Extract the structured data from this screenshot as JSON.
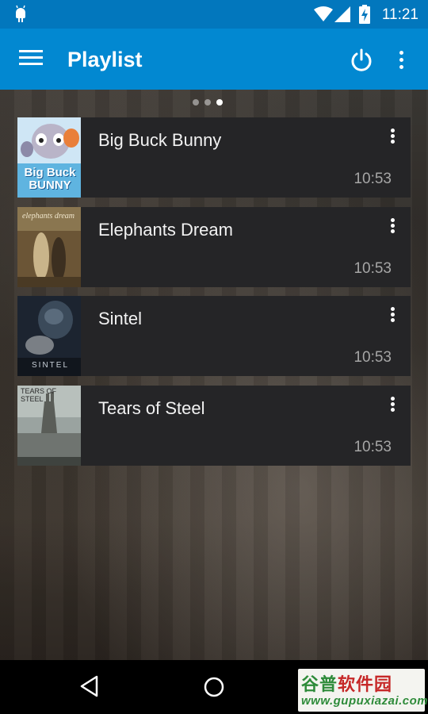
{
  "status_bar": {
    "time": "11:21"
  },
  "app_bar": {
    "title": "Playlist"
  },
  "pager": {
    "pages": 3,
    "active_index": 2
  },
  "playlist": [
    {
      "title": "Big Buck Bunny",
      "duration": "10:53",
      "thumb_label": "Big Buck BUNNY"
    },
    {
      "title": "Elephants Dream",
      "duration": "10:53",
      "thumb_label": "elephants dream"
    },
    {
      "title": "Sintel",
      "duration": "10:53",
      "thumb_label": "SINTEL"
    },
    {
      "title": "Tears of Steel",
      "duration": "10:53",
      "thumb_label": "TEARS OF STEEL"
    }
  ],
  "watermark": {
    "name_green": "谷普",
    "name_red": "软件园",
    "url": "www.gupuxiazai.com"
  },
  "colors": {
    "status_bar": "#0277bd",
    "app_bar": "#0288d1",
    "card": "#252527"
  },
  "icons": [
    "android-icon",
    "wifi-icon",
    "cell-signal-icon",
    "battery-charging-icon",
    "menu-icon",
    "power-icon",
    "overflow-menu-icon",
    "back-icon",
    "home-icon"
  ]
}
